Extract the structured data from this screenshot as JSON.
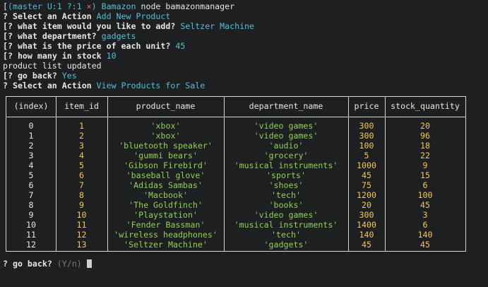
{
  "shell_line": {
    "bracket": "[",
    "branch": "(master U:1 ?:1",
    "x": "×",
    "close": ")",
    "dir": "Bamazon",
    "command": "node bamazonmanager"
  },
  "dialog": [
    {
      "prefix": "?",
      "question": "Select an Action",
      "answer": "Add New Product"
    },
    {
      "prefix": "[?",
      "question": "what item would you like to add?",
      "answer": "Seltzer Machine"
    },
    {
      "prefix": "[?",
      "question": "what department?",
      "answer": "gadgets"
    },
    {
      "prefix": "[?",
      "question": "what is the price of each unit?",
      "answer": "45"
    },
    {
      "prefix": "[?",
      "question": "how many in stock",
      "answer": "10"
    }
  ],
  "status_message": "product list updated",
  "dialog2": [
    {
      "prefix": "[?",
      "question": "go back?",
      "answer": "Yes"
    },
    {
      "prefix": "?",
      "question": "Select an Action",
      "answer": "View Products for Sale"
    }
  ],
  "table": {
    "headers": [
      "(index)",
      "item_id",
      "product_name",
      "department_name",
      "price",
      "stock_quantity"
    ],
    "rows": [
      {
        "index": "0",
        "item_id": "1",
        "product_name": "'xbox'",
        "department_name": "'video games'",
        "price": "300",
        "stock_quantity": "20"
      },
      {
        "index": "1",
        "item_id": "2",
        "product_name": "'xbox'",
        "department_name": "'video games'",
        "price": "300",
        "stock_quantity": "96"
      },
      {
        "index": "2",
        "item_id": "3",
        "product_name": "'bluetooth speaker'",
        "department_name": "'audio'",
        "price": "100",
        "stock_quantity": "18"
      },
      {
        "index": "3",
        "item_id": "4",
        "product_name": "'gummi bears'",
        "department_name": "'grocery'",
        "price": "5",
        "stock_quantity": "22"
      },
      {
        "index": "4",
        "item_id": "5",
        "product_name": "'Gibson Firebird'",
        "department_name": "'musical instruments'",
        "price": "1000",
        "stock_quantity": "9"
      },
      {
        "index": "5",
        "item_id": "6",
        "product_name": "'baseball glove'",
        "department_name": "'sports'",
        "price": "45",
        "stock_quantity": "15"
      },
      {
        "index": "6",
        "item_id": "7",
        "product_name": "'Adidas Sambas'",
        "department_name": "'shoes'",
        "price": "75",
        "stock_quantity": "6"
      },
      {
        "index": "7",
        "item_id": "8",
        "product_name": "'Macbook'",
        "department_name": "'tech'",
        "price": "1200",
        "stock_quantity": "100"
      },
      {
        "index": "8",
        "item_id": "9",
        "product_name": "'The Goldfinch'",
        "department_name": "'books'",
        "price": "20",
        "stock_quantity": "45"
      },
      {
        "index": "9",
        "item_id": "10",
        "product_name": "'Playstation'",
        "department_name": "'video games'",
        "price": "300",
        "stock_quantity": "3"
      },
      {
        "index": "10",
        "item_id": "11",
        "product_name": "'Fender Bassman'",
        "department_name": "'musical instruments'",
        "price": "1400",
        "stock_quantity": "6"
      },
      {
        "index": "11",
        "item_id": "12",
        "product_name": "'wireless headphones'",
        "department_name": "'tech'",
        "price": "140",
        "stock_quantity": "140"
      },
      {
        "index": "12",
        "item_id": "13",
        "product_name": "'Seltzer Machine'",
        "department_name": "'gadgets'",
        "price": "45",
        "stock_quantity": "45"
      }
    ]
  },
  "final_prompt": {
    "prefix": "?",
    "question": "go back?",
    "hint": "(Y/n)"
  },
  "colors": {
    "background": "#1d1f21",
    "cyan": "#4fc1d6",
    "green": "#8fd14f",
    "yellow": "#f5c945",
    "red": "#ff5f5f"
  }
}
